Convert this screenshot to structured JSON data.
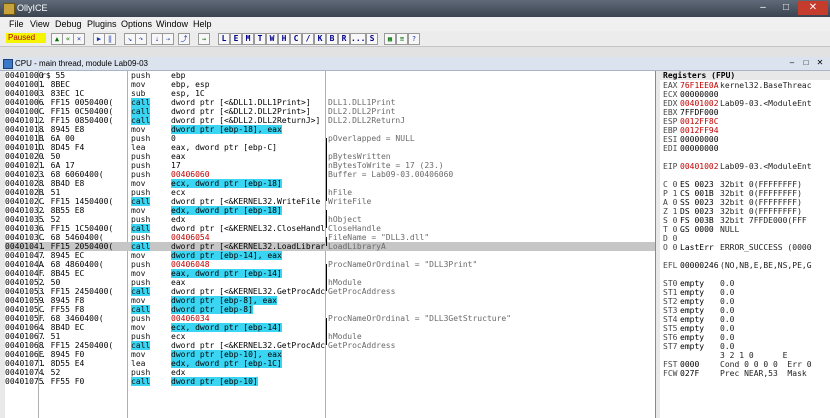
{
  "window": {
    "title": "OllyICE"
  },
  "menu": [
    "File",
    "View",
    "Debug",
    "Plugins",
    "Options",
    "Window",
    "Help"
  ],
  "toolbar": {
    "status": "Paused",
    "buttons": [
      {
        "icon": "open-file-icon",
        "glyph": "▲"
      },
      {
        "icon": "restart-icon",
        "glyph": "«"
      },
      {
        "icon": "close-icon",
        "glyph": "×"
      },
      {
        "icon": "run-icon",
        "glyph": "▶"
      },
      {
        "icon": "pause-icon",
        "glyph": "‖"
      },
      {
        "icon": "step-into-icon",
        "glyph": "↘"
      },
      {
        "icon": "step-over-icon",
        "glyph": "↷"
      },
      {
        "icon": "trace-into-icon",
        "glyph": "⇣"
      },
      {
        "icon": "trace-over-icon",
        "glyph": "⇢"
      },
      {
        "icon": "execute-till-return-icon",
        "glyph": "⤴"
      },
      {
        "icon": "go-to-icon",
        "glyph": "→"
      }
    ],
    "letter_buttons": [
      "L",
      "E",
      "M",
      "T",
      "W",
      "H",
      "C",
      "/",
      "K",
      "B",
      "R",
      "...",
      "S"
    ],
    "extra_buttons": [
      {
        "icon": "grid-icon",
        "glyph": "▦"
      },
      {
        "icon": "list-icon",
        "glyph": "≡"
      },
      {
        "icon": "help-icon",
        "glyph": "?"
      }
    ]
  },
  "cpu_window": {
    "title": "CPU - main thread, module Lab09-03"
  },
  "disasm": [
    {
      "addr": "00401000",
      "hex": "r$ 55",
      "mn": "push",
      "op": "ebp",
      "cm": ""
    },
    {
      "addr": "00401001",
      "hex": ". 8BEC",
      "mn": "mov",
      "op": "ebp, esp",
      "cm": ""
    },
    {
      "addr": "00401003",
      "hex": ". 83EC 1C",
      "mn": "sub",
      "op": "esp, 1C",
      "cm": ""
    },
    {
      "addr": "00401006",
      "hex": ". FF15 0050400(",
      "mn": "call",
      "op": "dword ptr [<&DLL1.DLL1Print>]",
      "cm": "DLL1.DLL1Print"
    },
    {
      "addr": "0040100C",
      "hex": ". FF15 0C50400(",
      "mn": "call",
      "op": "dword ptr [<&DLL2.DLL2Print>]",
      "cm": "DLL2.DLL2Print"
    },
    {
      "addr": "00401012",
      "hex": ". FF15 0850400(",
      "mn": "call",
      "op": "dword ptr [<&DLL2.DLL2ReturnJ>]",
      "cm": "DLL2.DLL2ReturnJ"
    },
    {
      "addr": "00401018",
      "hex": ". 8945 E8",
      "mn": "mov",
      "op": "dword ptr [ebp-18], eax",
      "cm": ""
    },
    {
      "addr": "0040101B",
      "hex": ". 6A 00",
      "mn": "push",
      "op": "0",
      "cm": "pOverlapped = NULL"
    },
    {
      "addr": "0040101D",
      "hex": ". 8D45 F4",
      "mn": "lea",
      "op": "eax, dword ptr [ebp-C]",
      "cm": ""
    },
    {
      "addr": "00401020",
      "hex": ". 50",
      "mn": "push",
      "op": "eax",
      "cm": "pBytesWritten"
    },
    {
      "addr": "00401021",
      "hex": ". 6A 17",
      "mn": "push",
      "op": "17",
      "cm": "nBytesToWrite = 17 (23.)"
    },
    {
      "addr": "00401023",
      "hex": ". 68 6060400(",
      "mn": "push",
      "op": "00406060",
      "cm": "Buffer = Lab09-03.00406060"
    },
    {
      "addr": "00401028",
      "hex": ". 8B4D E8",
      "mn": "mov",
      "op": "ecx, dword ptr [ebp-18]",
      "cm": ""
    },
    {
      "addr": "0040102B",
      "hex": ". 51",
      "mn": "push",
      "op": "ecx",
      "cm": "hFile"
    },
    {
      "addr": "0040102C",
      "hex": ". FF15 1450400(",
      "mn": "call",
      "op": "dword ptr [<&KERNEL32.WriteFile",
      "cm": "WriteFile"
    },
    {
      "addr": "00401032",
      "hex": ". 8B55 E8",
      "mn": "mov",
      "op": "edx, dword ptr [ebp-18]",
      "cm": ""
    },
    {
      "addr": "00401035",
      "hex": ". 52",
      "mn": "push",
      "op": "edx",
      "cm": "hObject"
    },
    {
      "addr": "00401036",
      "hex": ". FF15 1C50400(",
      "mn": "call",
      "op": "dword ptr [<&KERNEL32.CloseHandl",
      "cm": "CloseHandle"
    },
    {
      "addr": "0040103C",
      "hex": ". 68 5460400(",
      "mn": "push",
      "op": "00406054",
      "cm": "FileName = \"DLL3.dll\""
    },
    {
      "addr": "00401041",
      "hex": ". FF15 2050400(",
      "mn": "call",
      "op": "dword ptr [<&KERNEL32.LoadLibrar",
      "cm": "LoadLibraryA"
    },
    {
      "addr": "00401047",
      "hex": ". 8945 EC",
      "mn": "mov",
      "op": "dword ptr [ebp-14], eax",
      "cm": ""
    },
    {
      "addr": "0040104A",
      "hex": ". 68 4860400(",
      "mn": "push",
      "op": "00406048",
      "cm": "ProcNameOrOrdinal = \"DLL3Print\""
    },
    {
      "addr": "0040104F",
      "hex": ". 8B45 EC",
      "mn": "mov",
      "op": "eax, dword ptr [ebp-14]",
      "cm": ""
    },
    {
      "addr": "00401052",
      "hex": ". 50",
      "mn": "push",
      "op": "eax",
      "cm": "hModule"
    },
    {
      "addr": "00401053",
      "hex": ". FF15 2450400(",
      "mn": "call",
      "op": "dword ptr [<&KERNEL32.GetProcAdc",
      "cm": "GetProcAddress"
    },
    {
      "addr": "00401059",
      "hex": ". 8945 F8",
      "mn": "mov",
      "op": "dword ptr [ebp-8], eax",
      "cm": ""
    },
    {
      "addr": "0040105C",
      "hex": ". FF55 F8",
      "mn": "call",
      "op": "dword ptr [ebp-8]",
      "cm": ""
    },
    {
      "addr": "0040105F",
      "hex": ". 68 3460400(",
      "mn": "push",
      "op": "00406034",
      "cm": "ProcNameOrOrdinal = \"DLL3GetStructure\""
    },
    {
      "addr": "00401064",
      "hex": ". 8B4D EC",
      "mn": "mov",
      "op": "ecx, dword ptr [ebp-14]",
      "cm": ""
    },
    {
      "addr": "00401067",
      "hex": ". 51",
      "mn": "push",
      "op": "ecx",
      "cm": "hModule"
    },
    {
      "addr": "00401068",
      "hex": ". FF15 2450400(",
      "mn": "call",
      "op": "dword ptr [<&KERNEL32.GetProcAdc",
      "cm": "GetProcAddress"
    },
    {
      "addr": "0040106E",
      "hex": ". 8945 F0",
      "mn": "mov",
      "op": "dword ptr [ebp-10], eax",
      "cm": ""
    },
    {
      "addr": "00401071",
      "hex": ". 8D55 E4",
      "mn": "lea",
      "op": "edx, dword ptr [ebp-1C]",
      "cm": ""
    },
    {
      "addr": "00401074",
      "hex": ". 52",
      "mn": "push",
      "op": "edx",
      "cm": ""
    },
    {
      "addr": "00401075",
      "hex": ". FF55 F0",
      "mn": "call",
      "op": "dword ptr [ebp-10]",
      "cm": ""
    }
  ],
  "registers": {
    "title": "Registers (FPU)",
    "rows": [
      {
        "k": "EAX",
        "v": "76F1EE0A",
        "r": "kernel32.BaseThreac",
        "red": true
      },
      {
        "k": "ECX",
        "v": "00000000",
        "r": "",
        "red": false
      },
      {
        "k": "EDX",
        "v": "00401002",
        "r": "Lab09-03.<ModuleEnt",
        "red": true
      },
      {
        "k": "EBX",
        "v": "7FFDF000",
        "r": "",
        "red": false
      },
      {
        "k": "ESP",
        "v": "0012FF8C",
        "r": "",
        "red": true
      },
      {
        "k": "EBP",
        "v": "0012FF94",
        "r": "",
        "red": true
      },
      {
        "k": "ESI",
        "v": "00000000",
        "r": "",
        "red": false
      },
      {
        "k": "EDI",
        "v": "00000000",
        "r": "",
        "red": false
      },
      {
        "k": "",
        "v": "",
        "r": "",
        "red": false
      },
      {
        "k": "EIP",
        "v": "00401002",
        "r": "Lab09-03.<ModuleEnt",
        "red": true
      },
      {
        "k": "",
        "v": "",
        "r": "",
        "red": false
      },
      {
        "k": "C 0",
        "v": "ES 0023",
        "r": "32bit 0(FFFFFFFF)",
        "red": false
      },
      {
        "k": "P 1",
        "v": "CS 001B",
        "r": "32bit 0(FFFFFFFF)",
        "red": false
      },
      {
        "k": "A 0",
        "v": "SS 0023",
        "r": "32bit 0(FFFFFFFF)",
        "red": false
      },
      {
        "k": "Z 1",
        "v": "DS 0023",
        "r": "32bit 0(FFFFFFFF)",
        "red": false
      },
      {
        "k": "S 0",
        "v": "FS 003B",
        "r": "32bit 7FFDE000(FFF",
        "red": false
      },
      {
        "k": "T 0",
        "v": "GS 0000",
        "r": "NULL",
        "red": false
      },
      {
        "k": "D 0",
        "v": "",
        "r": "",
        "red": false
      },
      {
        "k": "O 0",
        "v": "LastErr",
        "r": "ERROR_SUCCESS (0000",
        "red": false
      },
      {
        "k": "",
        "v": "",
        "r": "",
        "red": false
      },
      {
        "k": "EFL",
        "v": "00000246",
        "r": "(NO,NB,E,BE,NS,PE,G",
        "red": false
      },
      {
        "k": "",
        "v": "",
        "r": "",
        "red": false
      },
      {
        "k": "ST0",
        "v": "empty",
        "r": "0.0",
        "red": false
      },
      {
        "k": "ST1",
        "v": "empty",
        "r": "0.0",
        "red": false
      },
      {
        "k": "ST2",
        "v": "empty",
        "r": "0.0",
        "red": false
      },
      {
        "k": "ST3",
        "v": "empty",
        "r": "0.0",
        "red": false
      },
      {
        "k": "ST4",
        "v": "empty",
        "r": "0.0",
        "red": false
      },
      {
        "k": "ST5",
        "v": "empty",
        "r": "0.0",
        "red": false
      },
      {
        "k": "ST6",
        "v": "empty",
        "r": "0.0",
        "red": false
      },
      {
        "k": "ST7",
        "v": "empty",
        "r": "0.0",
        "red": false
      },
      {
        "k": "",
        "v": "",
        "r": "3 2 1 0      E",
        "red": false
      },
      {
        "k": "FST",
        "v": "0000",
        "r": "Cond 0 0 0 0  Err 0",
        "red": false
      },
      {
        "k": "FCW",
        "v": "027F",
        "r": "Prec NEAR,53  Mask",
        "red": false
      }
    ]
  }
}
